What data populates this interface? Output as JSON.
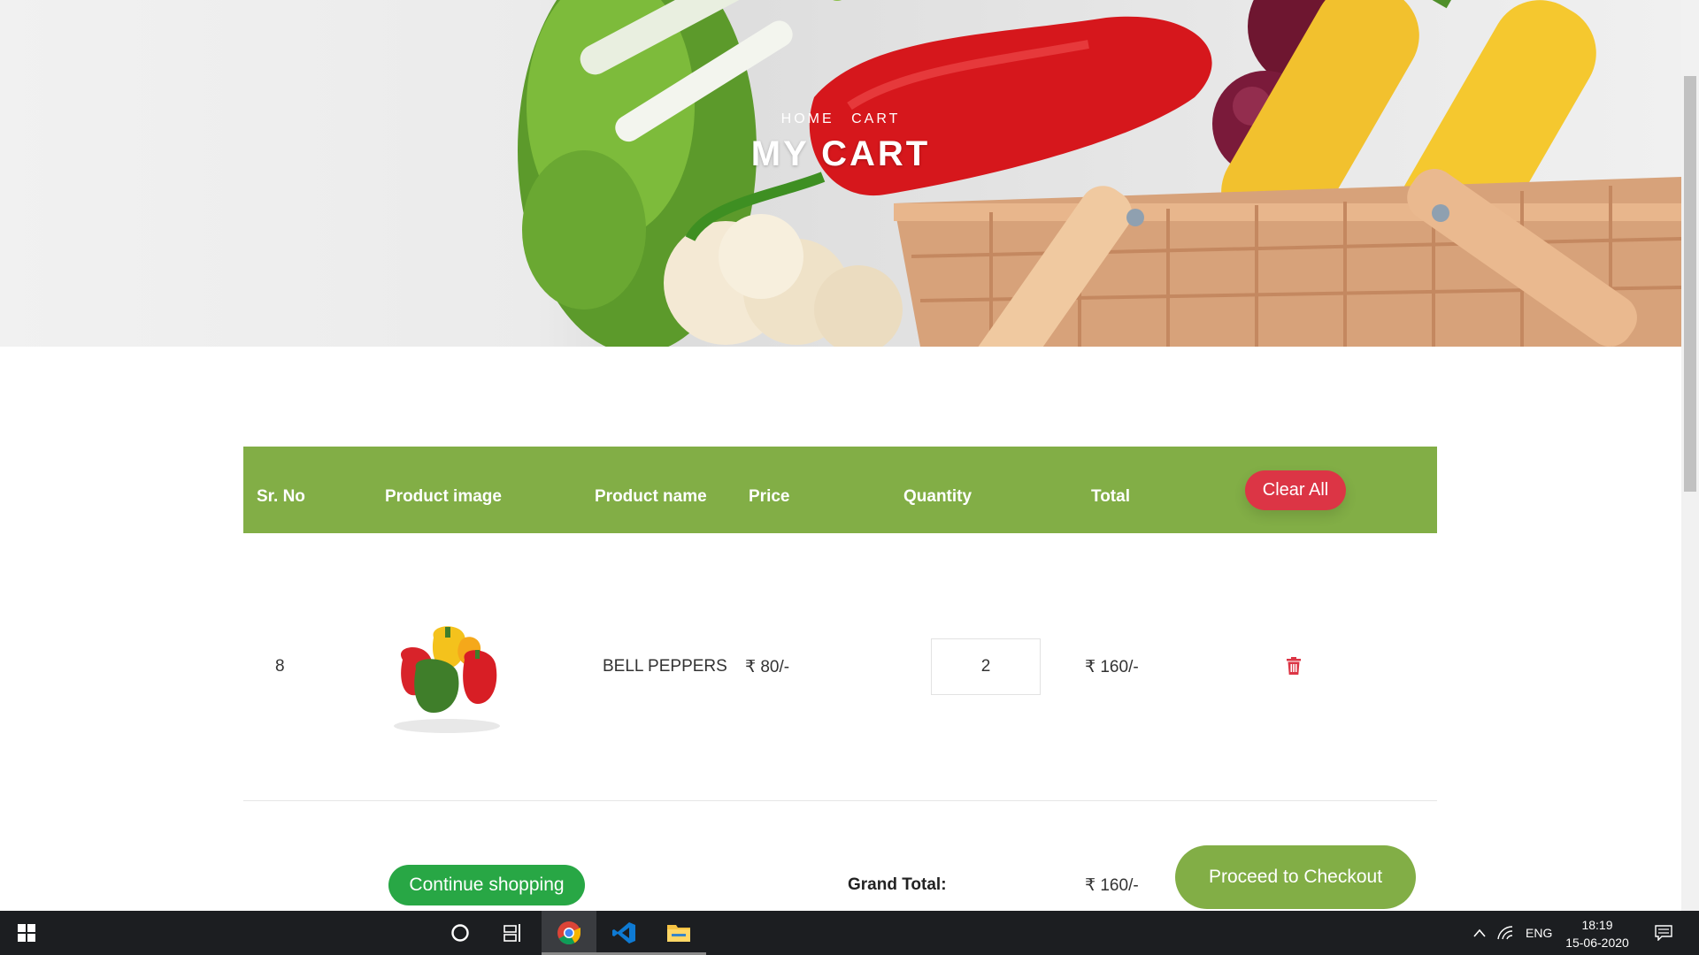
{
  "hero": {
    "breadcrumb": [
      "HOME",
      "CART"
    ],
    "title": "MY CART"
  },
  "table": {
    "headers": {
      "sr_no": "Sr. No",
      "image": "Product image",
      "name": "Product name",
      "price": "Price",
      "quantity": "Quantity",
      "total": "Total"
    },
    "clear_all_label": "Clear All",
    "rows": [
      {
        "sr_no": "8",
        "name": "BELL PEPPERS",
        "price": "₹ 80/-",
        "quantity": "2",
        "total": "₹ 160/-",
        "image_icon": "bell-peppers-image",
        "delete_icon": "trash-icon"
      }
    ]
  },
  "footer": {
    "continue_label": "Continue shopping",
    "grand_total_label": "Grand Total:",
    "grand_total_value": "₹ 160/-",
    "checkout_label": "Proceed to Checkout"
  },
  "taskbar": {
    "apps": [
      "windows-start-icon",
      "cortana-icon",
      "task-view-icon",
      "chrome-icon",
      "vscode-icon",
      "file-explorer-icon"
    ],
    "language": "ENG",
    "time": "18:19",
    "date": "15-06-2020"
  },
  "colors": {
    "accent_green": "#82ae46",
    "danger_red": "#dc3545",
    "success_green": "#28a745",
    "taskbar": "#1c1e21"
  }
}
